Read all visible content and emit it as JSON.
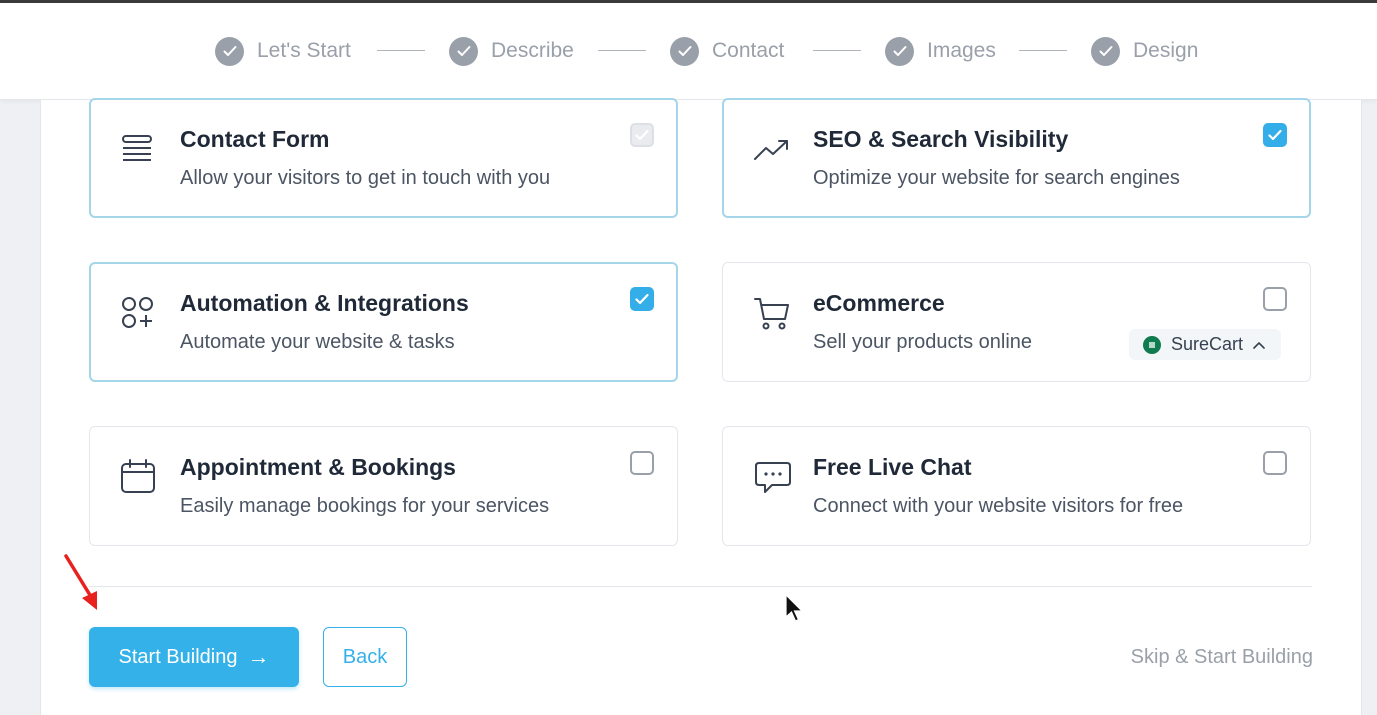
{
  "steps": [
    {
      "label": "Let's Start"
    },
    {
      "label": "Describe"
    },
    {
      "label": "Contact"
    },
    {
      "label": "Images"
    },
    {
      "label": "Design"
    }
  ],
  "features": [
    {
      "title": "Contact Form",
      "description": "Allow your visitors to get in touch with you",
      "icon": "list-lines-icon",
      "checked": true,
      "disabled": true
    },
    {
      "title": "SEO & Search Visibility",
      "description": "Optimize your website for search engines",
      "icon": "trending-up-icon",
      "checked": true
    },
    {
      "title": "Automation & Integrations",
      "description": "Automate your website & tasks",
      "icon": "apps-plus-icon",
      "checked": true
    },
    {
      "title": "eCommerce",
      "description": "Sell your products online",
      "icon": "shopping-cart-icon",
      "checked": false,
      "badge": "SureCart"
    },
    {
      "title": "Appointment & Bookings",
      "description": "Easily manage bookings for your services",
      "icon": "calendar-icon",
      "checked": false
    },
    {
      "title": "Free Live Chat",
      "description": "Connect with your website visitors for free",
      "icon": "chat-bubble-icon",
      "checked": false
    }
  ],
  "actions": {
    "start": "Start Building",
    "start_arrow": "→",
    "back": "Back",
    "skip": "Skip & Start Building"
  },
  "colors": {
    "accent": "#35b1ea",
    "selected_border": "#a5d5ea",
    "step_grey": "#9aa0a9"
  }
}
